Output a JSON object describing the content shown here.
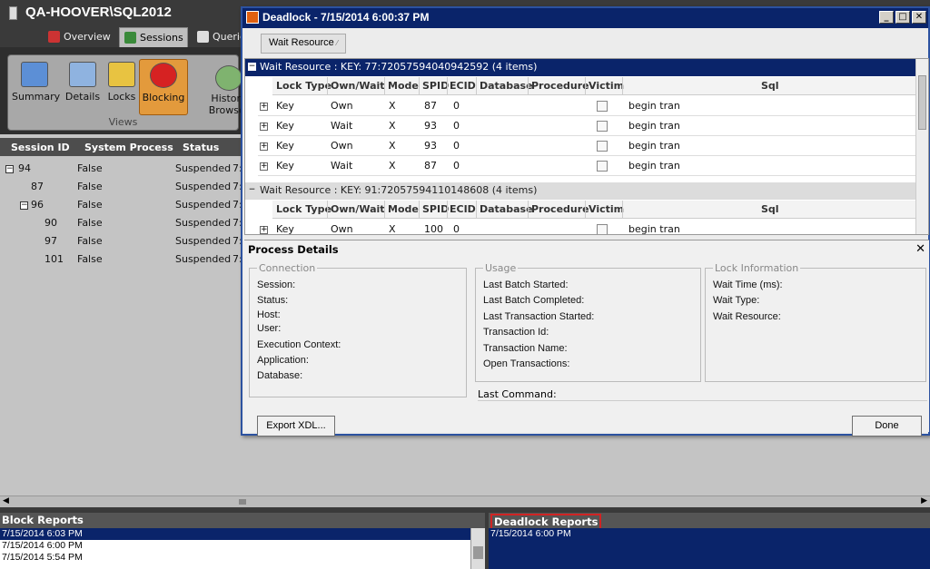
{
  "app": {
    "server_title": "QA-HOOVER\\SQL2012",
    "tabs": [
      {
        "label": "Overview"
      },
      {
        "label": "Sessions"
      },
      {
        "label": "Querie"
      }
    ],
    "ribbon": {
      "buttons": [
        {
          "label": "Summary"
        },
        {
          "label": "Details"
        },
        {
          "label": "Locks"
        },
        {
          "label": "Blocking"
        }
      ],
      "group_label": "Views",
      "history_label": "History Browser"
    },
    "session_grid": {
      "columns": [
        "Session ID",
        "System Process",
        "Status"
      ],
      "rows": [
        {
          "id": "94",
          "system": "False",
          "status": "Suspended",
          "trail": "7:"
        },
        {
          "id": "87",
          "system": "False",
          "status": "Suspended",
          "trail": "7:"
        },
        {
          "id": "96",
          "system": "False",
          "status": "Suspended",
          "trail": "7:"
        },
        {
          "id": "90",
          "system": "False",
          "status": "Suspended",
          "trail": "7:"
        },
        {
          "id": "97",
          "system": "False",
          "status": "Suspended",
          "trail": "7:"
        },
        {
          "id": "101",
          "system": "False",
          "status": "Suspended",
          "trail": "7:"
        }
      ]
    },
    "block_reports": {
      "title": "Block Reports",
      "items": [
        "7/15/2014 6:03 PM",
        "7/15/2014 6:00 PM",
        "7/15/2014 5:54 PM"
      ]
    },
    "deadlock_reports": {
      "title": "Deadlock Reports",
      "items": [
        "7/15/2014 6:00 PM"
      ]
    }
  },
  "dialog": {
    "title": "Deadlock - 7/15/2014 6:00:37 PM",
    "minimize": "_",
    "maximize": "□",
    "close": "✕",
    "group_by_chip": "Wait Resource",
    "columns": [
      "Lock Type",
      "Own/Wait",
      "Mode",
      "SPID",
      "ECID",
      "Database",
      "Procedure",
      "Victim",
      "Sql"
    ],
    "groups": [
      {
        "header": "Wait Resource : KEY: 77:72057594040942592 (4 items)",
        "rows": [
          {
            "lock_type": "Key",
            "own_wait": "Own",
            "mode": "X",
            "spid": "87",
            "ecid": "0",
            "sql": "begin tran"
          },
          {
            "lock_type": "Key",
            "own_wait": "Wait",
            "mode": "X",
            "spid": "93",
            "ecid": "0",
            "sql": "begin tran"
          },
          {
            "lock_type": "Key",
            "own_wait": "Own",
            "mode": "X",
            "spid": "93",
            "ecid": "0",
            "sql": "begin tran"
          },
          {
            "lock_type": "Key",
            "own_wait": "Wait",
            "mode": "X",
            "spid": "87",
            "ecid": "0",
            "sql": "begin tran"
          }
        ]
      },
      {
        "header": "Wait Resource : KEY: 91:72057594110148608 (4 items)",
        "rows": [
          {
            "lock_type": "Key",
            "own_wait": "Own",
            "mode": "X",
            "spid": "100",
            "ecid": "0",
            "sql": "begin tran"
          }
        ]
      }
    ],
    "process_details": {
      "title": "Process Details",
      "close": "✕",
      "connection": {
        "legend": "Connection",
        "labels": [
          "Session:",
          "Status:",
          "Host:",
          "User:",
          "Execution Context:",
          "Application:",
          "Database:"
        ]
      },
      "usage": {
        "legend": "Usage",
        "labels": [
          "Last Batch Started:",
          "Last Batch Completed:",
          "Last Transaction Started:",
          "Transaction Id:",
          "Transaction Name:",
          "Open Transactions:"
        ]
      },
      "lock_info": {
        "legend": "Lock Information",
        "labels": [
          "Wait Time (ms):",
          "Wait Type:",
          "Wait Resource:"
        ]
      },
      "last_command_label": "Last Command:",
      "export_button": "Export XDL...",
      "done_button": "Done"
    }
  },
  "colors": {
    "group_header_active": "#0a246a",
    "group_header_inactive": "#dcdcdc",
    "blocking_button": "#e39a3c",
    "highlight_border": "#d12323"
  }
}
